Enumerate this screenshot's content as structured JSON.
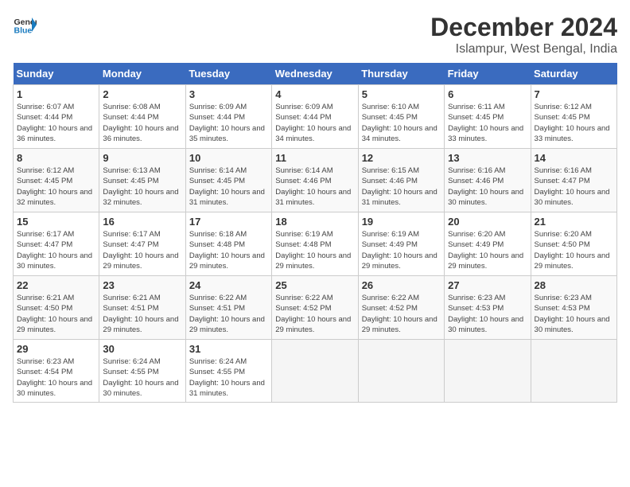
{
  "header": {
    "logo_line1": "General",
    "logo_line2": "Blue",
    "month_title": "December 2024",
    "location": "Islampur, West Bengal, India"
  },
  "weekdays": [
    "Sunday",
    "Monday",
    "Tuesday",
    "Wednesday",
    "Thursday",
    "Friday",
    "Saturday"
  ],
  "weeks": [
    [
      {
        "day": "1",
        "sunrise": "6:07 AM",
        "sunset": "4:44 PM",
        "daylight": "10 hours and 36 minutes."
      },
      {
        "day": "2",
        "sunrise": "6:08 AM",
        "sunset": "4:44 PM",
        "daylight": "10 hours and 36 minutes."
      },
      {
        "day": "3",
        "sunrise": "6:09 AM",
        "sunset": "4:44 PM",
        "daylight": "10 hours and 35 minutes."
      },
      {
        "day": "4",
        "sunrise": "6:09 AM",
        "sunset": "4:44 PM",
        "daylight": "10 hours and 34 minutes."
      },
      {
        "day": "5",
        "sunrise": "6:10 AM",
        "sunset": "4:45 PM",
        "daylight": "10 hours and 34 minutes."
      },
      {
        "day": "6",
        "sunrise": "6:11 AM",
        "sunset": "4:45 PM",
        "daylight": "10 hours and 33 minutes."
      },
      {
        "day": "7",
        "sunrise": "6:12 AM",
        "sunset": "4:45 PM",
        "daylight": "10 hours and 33 minutes."
      }
    ],
    [
      {
        "day": "8",
        "sunrise": "6:12 AM",
        "sunset": "4:45 PM",
        "daylight": "10 hours and 32 minutes."
      },
      {
        "day": "9",
        "sunrise": "6:13 AM",
        "sunset": "4:45 PM",
        "daylight": "10 hours and 32 minutes."
      },
      {
        "day": "10",
        "sunrise": "6:14 AM",
        "sunset": "4:45 PM",
        "daylight": "10 hours and 31 minutes."
      },
      {
        "day": "11",
        "sunrise": "6:14 AM",
        "sunset": "4:46 PM",
        "daylight": "10 hours and 31 minutes."
      },
      {
        "day": "12",
        "sunrise": "6:15 AM",
        "sunset": "4:46 PM",
        "daylight": "10 hours and 31 minutes."
      },
      {
        "day": "13",
        "sunrise": "6:16 AM",
        "sunset": "4:46 PM",
        "daylight": "10 hours and 30 minutes."
      },
      {
        "day": "14",
        "sunrise": "6:16 AM",
        "sunset": "4:47 PM",
        "daylight": "10 hours and 30 minutes."
      }
    ],
    [
      {
        "day": "15",
        "sunrise": "6:17 AM",
        "sunset": "4:47 PM",
        "daylight": "10 hours and 30 minutes."
      },
      {
        "day": "16",
        "sunrise": "6:17 AM",
        "sunset": "4:47 PM",
        "daylight": "10 hours and 29 minutes."
      },
      {
        "day": "17",
        "sunrise": "6:18 AM",
        "sunset": "4:48 PM",
        "daylight": "10 hours and 29 minutes."
      },
      {
        "day": "18",
        "sunrise": "6:19 AM",
        "sunset": "4:48 PM",
        "daylight": "10 hours and 29 minutes."
      },
      {
        "day": "19",
        "sunrise": "6:19 AM",
        "sunset": "4:49 PM",
        "daylight": "10 hours and 29 minutes."
      },
      {
        "day": "20",
        "sunrise": "6:20 AM",
        "sunset": "4:49 PM",
        "daylight": "10 hours and 29 minutes."
      },
      {
        "day": "21",
        "sunrise": "6:20 AM",
        "sunset": "4:50 PM",
        "daylight": "10 hours and 29 minutes."
      }
    ],
    [
      {
        "day": "22",
        "sunrise": "6:21 AM",
        "sunset": "4:50 PM",
        "daylight": "10 hours and 29 minutes."
      },
      {
        "day": "23",
        "sunrise": "6:21 AM",
        "sunset": "4:51 PM",
        "daylight": "10 hours and 29 minutes."
      },
      {
        "day": "24",
        "sunrise": "6:22 AM",
        "sunset": "4:51 PM",
        "daylight": "10 hours and 29 minutes."
      },
      {
        "day": "25",
        "sunrise": "6:22 AM",
        "sunset": "4:52 PM",
        "daylight": "10 hours and 29 minutes."
      },
      {
        "day": "26",
        "sunrise": "6:22 AM",
        "sunset": "4:52 PM",
        "daylight": "10 hours and 29 minutes."
      },
      {
        "day": "27",
        "sunrise": "6:23 AM",
        "sunset": "4:53 PM",
        "daylight": "10 hours and 30 minutes."
      },
      {
        "day": "28",
        "sunrise": "6:23 AM",
        "sunset": "4:53 PM",
        "daylight": "10 hours and 30 minutes."
      }
    ],
    [
      {
        "day": "29",
        "sunrise": "6:23 AM",
        "sunset": "4:54 PM",
        "daylight": "10 hours and 30 minutes."
      },
      {
        "day": "30",
        "sunrise": "6:24 AM",
        "sunset": "4:55 PM",
        "daylight": "10 hours and 30 minutes."
      },
      {
        "day": "31",
        "sunrise": "6:24 AM",
        "sunset": "4:55 PM",
        "daylight": "10 hours and 31 minutes."
      },
      null,
      null,
      null,
      null
    ]
  ]
}
